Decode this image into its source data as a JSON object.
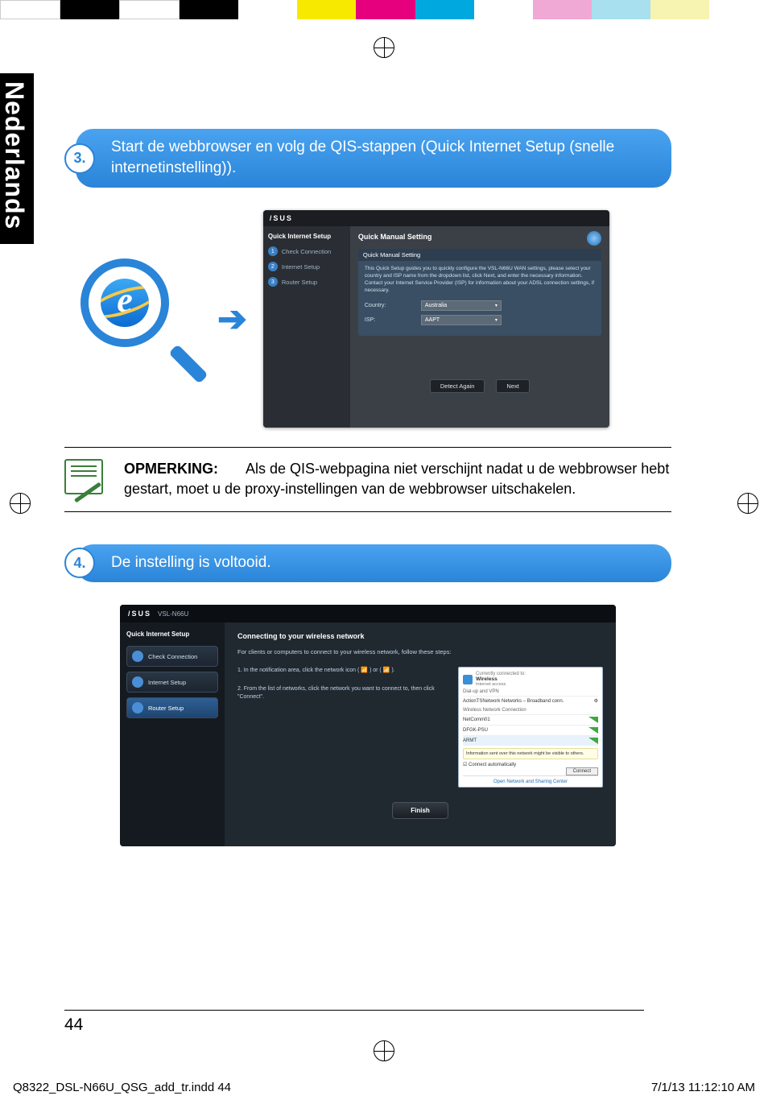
{
  "meta": {
    "language_tab": "Nederlands",
    "page_number": "44",
    "footer_file": "Q8322_DSL-N66U_QSG_add_tr.indd   44",
    "footer_time": "7/1/13   11:12:10 AM"
  },
  "step3": {
    "number": "3.",
    "text": "Start de webbrowser en volg de QIS-stappen (Quick Internet Setup (snelle internetinstelling))."
  },
  "step4": {
    "number": "4.",
    "text": "De instelling is voltooid."
  },
  "note": {
    "label": "OPMERKING:",
    "text": "Als de QIS-webpagina niet verschijnt nadat u de webbrowser hebt gestart, moet u de proxy-instellingen van de webbrowser uitschakelen."
  },
  "arrow": "➔",
  "qis1": {
    "brand": "/SUS",
    "sidebar_heading": "Quick Internet Setup",
    "nav": [
      "Check Connection",
      "Internet Setup",
      "Router Setup"
    ],
    "title": "Quick Manual Setting",
    "panel_title": "Quick Manual Setting",
    "panel_desc": "This Quick Setup guides you to quickly configure the VSL-N66U WAN settings, please select your country and ISP name from the dropdown list, click Next, and enter the necessary information. Contact your Internet Service Provider (ISP) for information about your ADSL connection settings, if necessary.",
    "country_label": "Country:",
    "country_value": "Australia",
    "isp_label": "ISP:",
    "isp_value": "AAPT",
    "btn_detect": "Detect Again",
    "btn_next": "Next"
  },
  "qis2": {
    "brand": "/SUS",
    "model": "VSL-N66U",
    "sidebar_heading": "Quick Internet Setup",
    "nav": [
      {
        "label": "Check Connection",
        "active": false
      },
      {
        "label": "Internet Setup",
        "active": false
      },
      {
        "label": "Router Setup",
        "active": true
      }
    ],
    "title": "Connecting to your wireless network",
    "subtitle": "For clients or computers to connect to your wireless network, follow these steps:",
    "inst1": "1. In the notification area, click the network icon ( 📶 ) or ( 📶 ).",
    "inst2": "2. From the list of networks, click the network you want to connect to, then click \"Connect\".",
    "window": {
      "status_line1": "Currently connected to:",
      "status_line2": "Wireless",
      "status_line3": "Internet access",
      "section": "Dial-up and VPN",
      "row1": "ActionTSNetwork Networks – Broadband conn.",
      "section2": "Wireless Network Connection",
      "rows": [
        "NetComm01",
        "DFGK-PSU",
        "ARMT"
      ],
      "tip": "Information sent over this network might be visible to others.",
      "auto": "☑ Connect automatically",
      "connect": "Connect",
      "footer": "Open Network and Sharing Center"
    },
    "finish": "Finish"
  }
}
